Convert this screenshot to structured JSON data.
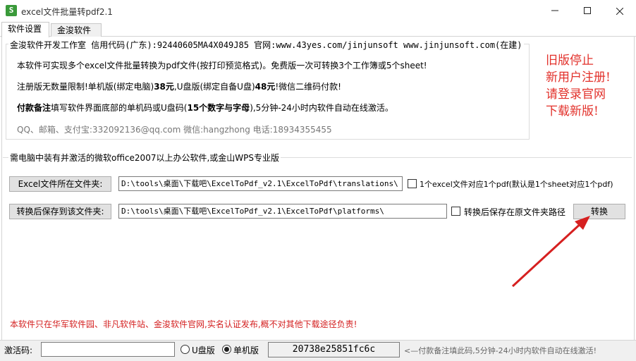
{
  "window": {
    "title": "excel文件批量转pdf2.1",
    "app_icon_glyph": "S",
    "minimize_icon": "minimize-icon",
    "maximize_icon": "maximize-icon",
    "close_icon": "close-icon"
  },
  "tabs": [
    {
      "label": "软件设置",
      "active": true
    },
    {
      "label": "金浚软件",
      "active": false
    }
  ],
  "info": {
    "legend": "金浚软件开发工作室 信用代码(广东):92440605MA4X049J85 官网:www.43yes.com/jinjunsoft  www.jinjunsoft.com(在建)",
    "line1": "本软件可实现多个excel文件批量转换为pdf文件(按打印预览格式)。免费版一次可转换3个工作簿或5个sheet!",
    "line2_a": "注册版无数量限制!单机版(绑定电脑)",
    "line2_b": "38元",
    "line2_c": ",U盘版(绑定自备U盘)",
    "line2_d": "48元",
    "line2_e": "!微信二维码付款!",
    "line3_a": "付款备注",
    "line3_b": "填写软件界面底部的单机码或U盘码(",
    "line3_c": "15个数字与字母",
    "line3_d": "),5分钟-24小时内软件自动在线激活。",
    "line4": "QQ、邮箱、支付宝:332092136@qq.com   微信:hangzhong   电话:18934355455"
  },
  "notice": {
    "line1": "旧版停止",
    "line2": "新用户注册!",
    "line3": "请登录官网",
    "line4": "下载新版!",
    "color": "#e2302a"
  },
  "convert_group": {
    "legend": "需电脑中装有并激活的微软office2007以上办公软件,或金山WPS专业版",
    "source_button": "Excel文件所在文件夹:",
    "source_path": "D:\\tools\\桌面\\下载吧\\ExcelToPdf_v2.1\\ExcelToPdf\\translations\\",
    "one_to_one_label": "1个excel文件对应1个pdf(默认是1个sheet对应1个pdf)",
    "one_to_one_checked": false,
    "dest_button": "转换后保存到该文件夹:",
    "dest_path": "D:\\tools\\桌面\\下载吧\\ExcelToPdf_v2.1\\ExcelToPdf\\platforms\\",
    "save_original_label": "转换后保存在原文件夹路径",
    "save_original_checked": false,
    "convert_button": "转换"
  },
  "warning": {
    "text": "本软件只在华军软件园、非凡软件站、金浚软件官网,实名认证发布,概不对其他下载途径负责!",
    "color": "#d42020"
  },
  "footer": {
    "activation_label": "激活码:",
    "activation_value": "",
    "radio_usb": "U盘版",
    "radio_standalone": "单机版",
    "selected": "单机版",
    "machine_code": "20738e25851fc6c",
    "tip": "<—付款备注填此码,5分钟-24小时内软件自动在线激活!"
  }
}
